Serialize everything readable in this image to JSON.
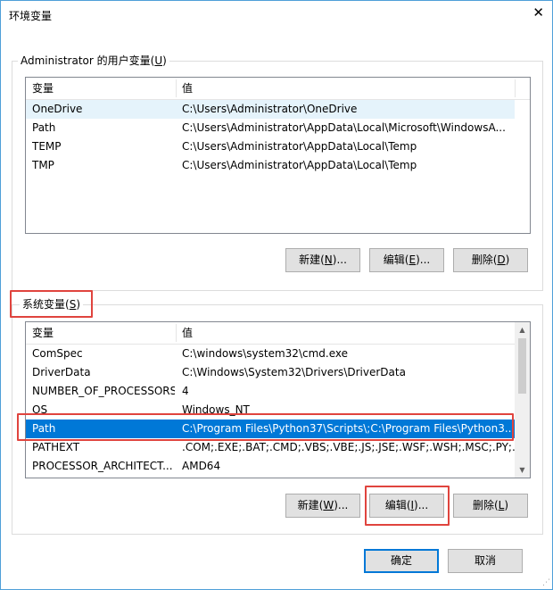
{
  "window": {
    "title": "环境变量",
    "close_glyph": "✕"
  },
  "user_vars": {
    "label_prefix": "Administrator 的用户变量(",
    "label_key": "U",
    "label_suffix": ")",
    "col_name": "变量",
    "col_value": "值",
    "rows": [
      {
        "name": "OneDrive",
        "value": "C:\\Users\\Administrator\\OneDrive"
      },
      {
        "name": "Path",
        "value": "C:\\Users\\Administrator\\AppData\\Local\\Microsoft\\WindowsA..."
      },
      {
        "name": "TEMP",
        "value": "C:\\Users\\Administrator\\AppData\\Local\\Temp"
      },
      {
        "name": "TMP",
        "value": "C:\\Users\\Administrator\\AppData\\Local\\Temp"
      }
    ],
    "buttons": {
      "new": {
        "pre": "新建(",
        "key": "N",
        "post": ")..."
      },
      "edit": {
        "pre": "编辑(",
        "key": "E",
        "post": ")..."
      },
      "delete": {
        "pre": "删除(",
        "key": "D",
        "post": ")"
      }
    }
  },
  "sys_vars": {
    "label_prefix": "系统变量(",
    "label_key": "S",
    "label_suffix": ")",
    "col_name": "变量",
    "col_value": "值",
    "rows": [
      {
        "name": "ComSpec",
        "value": "C:\\windows\\system32\\cmd.exe"
      },
      {
        "name": "DriverData",
        "value": "C:\\Windows\\System32\\Drivers\\DriverData"
      },
      {
        "name": "NUMBER_OF_PROCESSORS",
        "value": "4"
      },
      {
        "name": "OS",
        "value": "Windows_NT"
      },
      {
        "name": "Path",
        "value": "C:\\Program Files\\Python37\\Scripts\\;C:\\Program Files\\Python3..."
      },
      {
        "name": "PATHEXT",
        "value": ".COM;.EXE;.BAT;.CMD;.VBS;.VBE;.JS;.JSE;.WSF;.WSH;.MSC;.PY;.P..."
      },
      {
        "name": "PROCESSOR_ARCHITECT...",
        "value": "AMD64"
      }
    ],
    "selected_row": "Path",
    "buttons": {
      "new": {
        "pre": "新建(",
        "key": "W",
        "post": ")..."
      },
      "edit": {
        "pre": "编辑(",
        "key": "I",
        "post": ")..."
      },
      "delete": {
        "pre": "删除(",
        "key": "L",
        "post": ")"
      }
    }
  },
  "footer": {
    "ok": "确定",
    "cancel": "取消"
  },
  "colors": {
    "selection": "#0078d7",
    "highlight_box": "#e0443e"
  },
  "icons": {
    "close": "close-icon",
    "scroll_up": "scroll-up-arrow-icon",
    "scroll_down": "scroll-down-arrow-icon"
  }
}
